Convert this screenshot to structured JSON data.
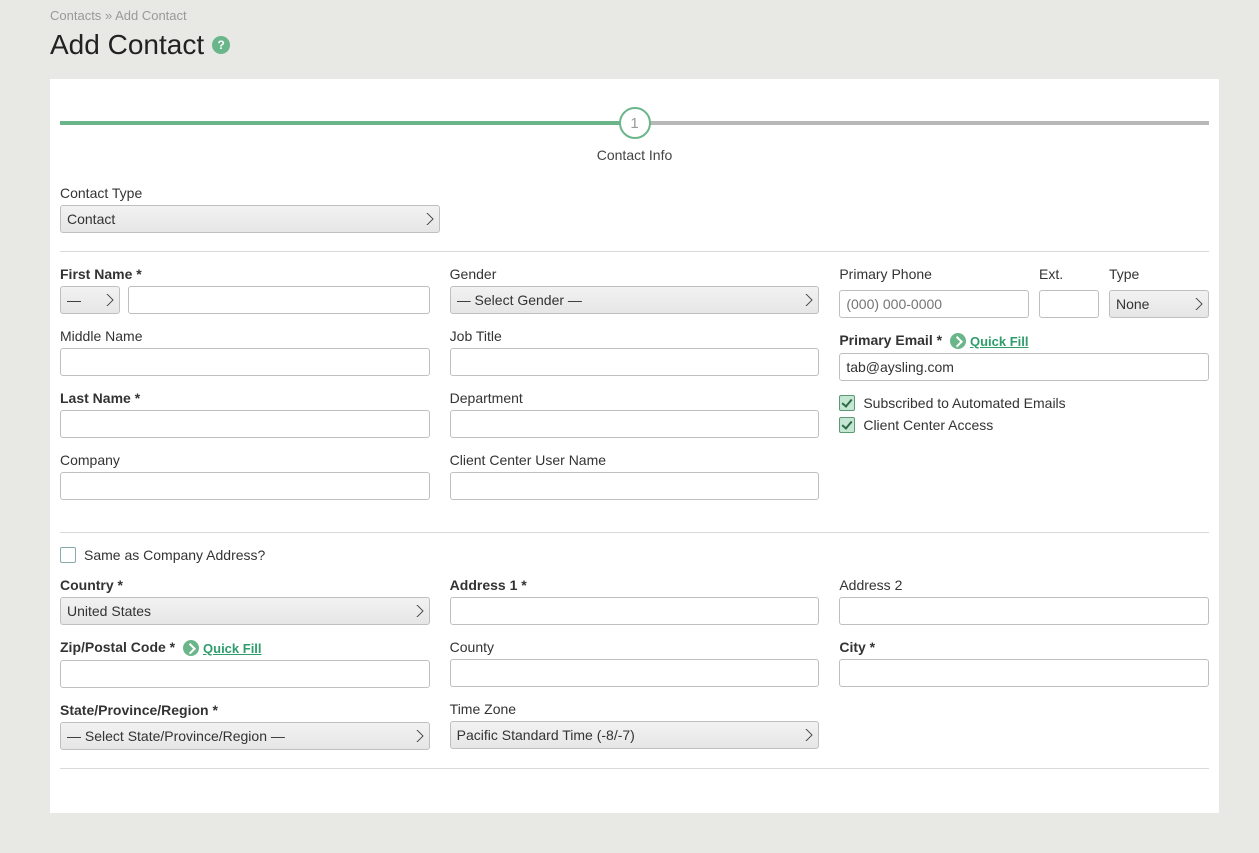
{
  "breadcrumb": {
    "root": "Contacts",
    "sep": "»",
    "current": "Add Contact"
  },
  "page_title": "Add Contact",
  "stepper": {
    "num": "1",
    "label": "Contact Info"
  },
  "contact_type": {
    "label": "Contact Type",
    "value": "Contact"
  },
  "first_name": {
    "label": "First Name *",
    "prefix": "—",
    "value": ""
  },
  "middle_name": {
    "label": "Middle Name",
    "value": ""
  },
  "last_name": {
    "label": "Last Name *",
    "value": ""
  },
  "company": {
    "label": "Company",
    "value": ""
  },
  "gender": {
    "label": "Gender",
    "value": "— Select Gender —"
  },
  "job_title": {
    "label": "Job Title",
    "value": ""
  },
  "department": {
    "label": "Department",
    "value": ""
  },
  "client_user": {
    "label": "Client Center User Name",
    "value": ""
  },
  "phone": {
    "label": "Primary Phone",
    "placeholder": "(000) 000-0000",
    "value": ""
  },
  "ext": {
    "label": "Ext.",
    "value": ""
  },
  "phone_type": {
    "label": "Type",
    "value": "None"
  },
  "email": {
    "label": "Primary Email *",
    "value": "tab@aysling.com",
    "quick_fill": "Quick Fill"
  },
  "sub_auto": "Subscribed to Automated Emails",
  "client_access": "Client Center Access",
  "same_as": "Same as Company Address?",
  "country": {
    "label": "Country *",
    "value": "United States"
  },
  "zip": {
    "label": "Zip/Postal Code *",
    "quick_fill": "Quick Fill",
    "value": ""
  },
  "state": {
    "label": "State/Province/Region *",
    "value": "— Select State/Province/Region —"
  },
  "addr1": {
    "label": "Address 1 *",
    "value": ""
  },
  "county": {
    "label": "County",
    "value": ""
  },
  "timezone": {
    "label": "Time Zone",
    "value": "Pacific Standard Time (-8/-7)"
  },
  "addr2": {
    "label": "Address 2",
    "value": ""
  },
  "city": {
    "label": "City *",
    "value": ""
  }
}
